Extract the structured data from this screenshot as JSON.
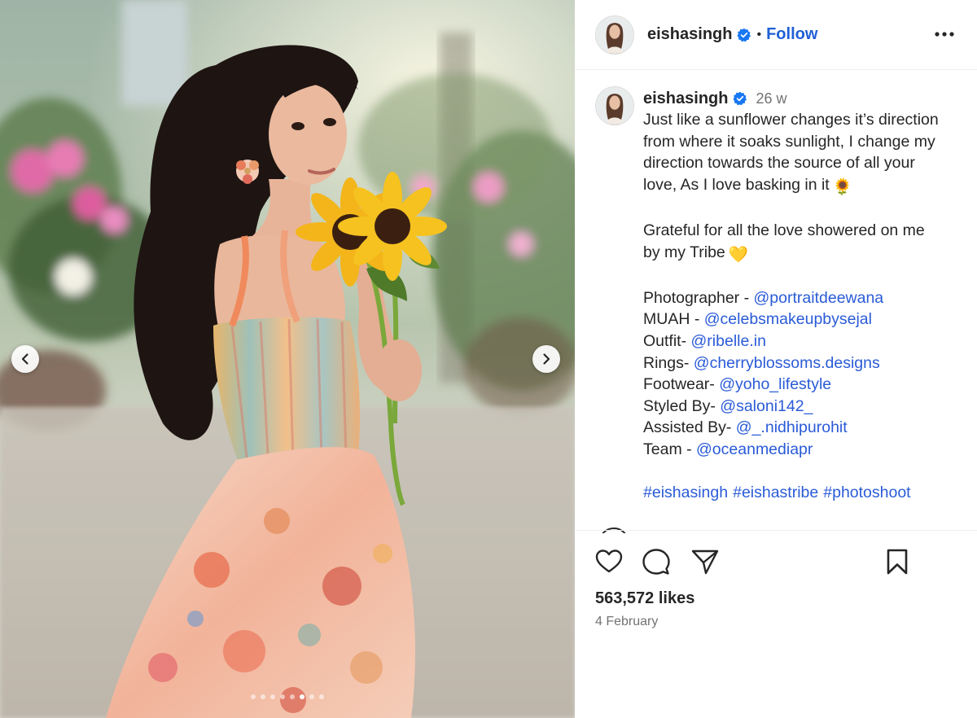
{
  "post": {
    "header": {
      "username": "eishasingh",
      "separator": "•",
      "follow_label": "Follow",
      "more_icon": "more-horizontal-icon"
    },
    "caption": {
      "username": "eishasingh",
      "time_ago": "26 w",
      "lines": [
        "Just like a sunflower changes it’s direction",
        "from where it soaks sunlight, I change my",
        "direction towards the source of all your",
        "love, As I love basking in it"
      ],
      "sunflower_emoji": "🌻",
      "grateful_lines": [
        "Grateful for all the love showered on me",
        "by my Tribe"
      ],
      "heart_emoji": "💛",
      "credits": [
        {
          "label": "Photographer - ",
          "handle": "@portraitdeewana"
        },
        {
          "label": "MUAH - ",
          "handle": "@celebsmakeupbysejal"
        },
        {
          "label": "Outfit- ",
          "handle": "@ribelle.in"
        },
        {
          "label": "Rings- ",
          "handle": "@cherryblossoms.designs"
        },
        {
          "label": "Footwear- ",
          "handle": "@yoho_lifestyle"
        },
        {
          "label": "Styled By- ",
          "handle": "@saloni142_"
        },
        {
          "label": "Assisted By- ",
          "handle": "@_.nidhipurohit"
        },
        {
          "label": "Team - ",
          "handle": "@oceanmediapr"
        }
      ],
      "hashtags": [
        "#eishasingh",
        "#eishastribe",
        "#photoshoot"
      ]
    },
    "likes_text": "563,572 likes",
    "date_text": "4 February",
    "carousel": {
      "slide_count": 8,
      "active_index": 5,
      "prev_icon": "chevron-left-icon",
      "next_icon": "chevron-right-icon"
    },
    "colors": {
      "link": "#2a5bd7",
      "follow": "#1f5fd6",
      "verified": "#1877f2",
      "text": "#262626",
      "muted": "#737373"
    }
  }
}
